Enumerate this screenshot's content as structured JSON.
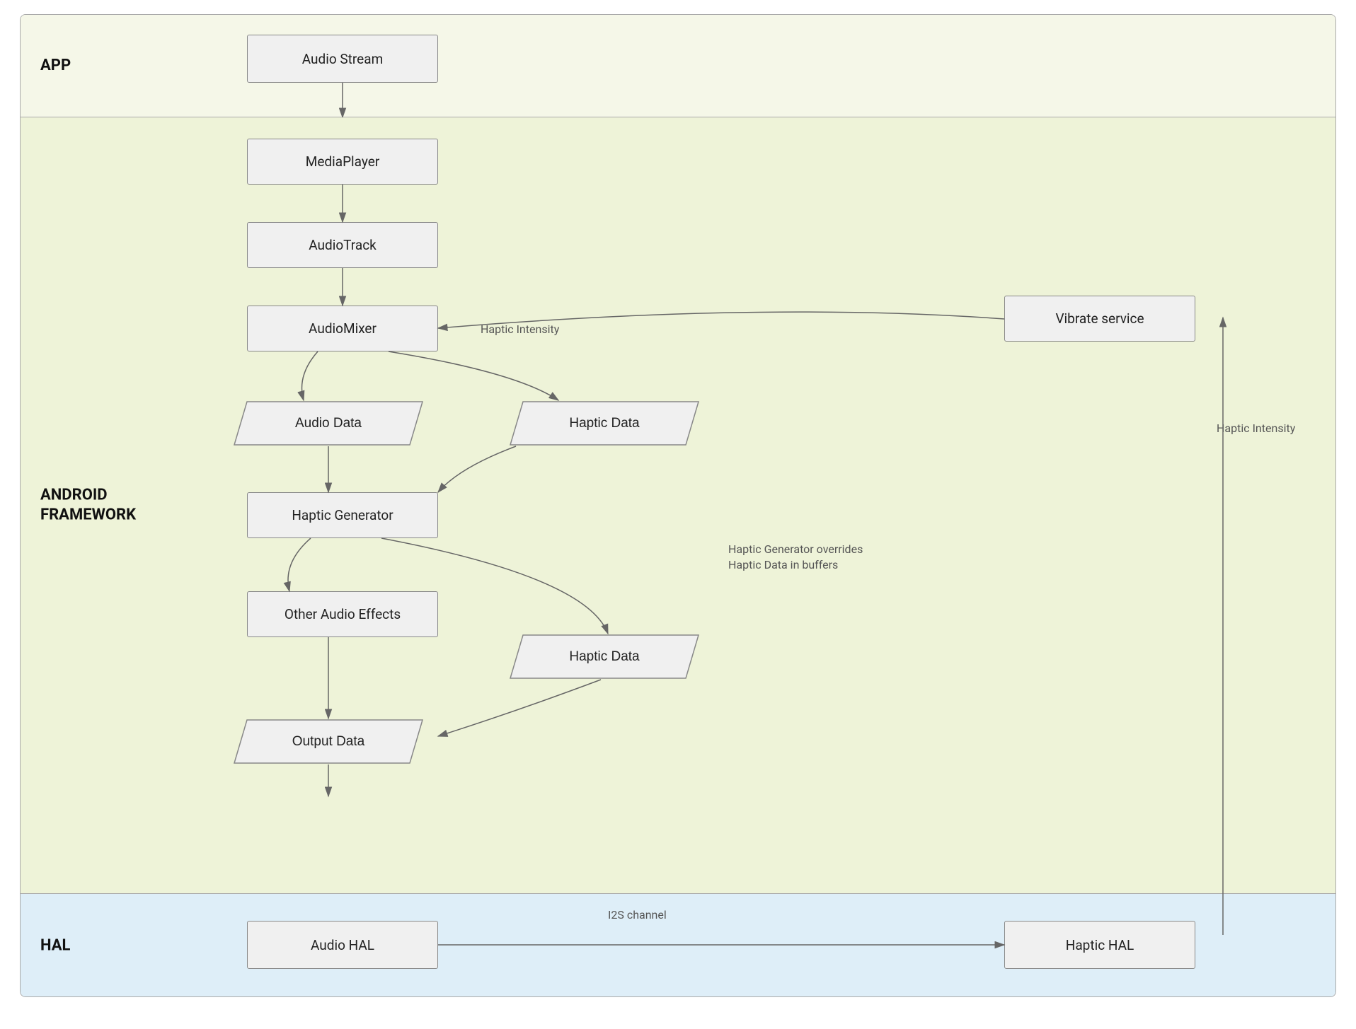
{
  "sections": {
    "app": {
      "label": "APP",
      "bg": "#f5f7e8"
    },
    "framework": {
      "label": "ANDROID\nFRAMEWORK",
      "bg": "#eef3d8"
    },
    "hal": {
      "label": "HAL",
      "bg": "#deeef8"
    }
  },
  "boxes": {
    "audio_stream": "Audio Stream",
    "media_player": "MediaPlayer",
    "audio_track": "AudioTrack",
    "audio_mixer": "AudioMixer",
    "vibrate_service": "Vibrate service",
    "audio_data": "Audio Data",
    "haptic_data_1": "Haptic Data",
    "haptic_generator": "Haptic Generator",
    "other_audio_effects": "Other Audio Effects",
    "haptic_data_2": "Haptic Data",
    "output_data": "Output Data",
    "audio_hal": "Audio HAL",
    "haptic_hal": "Haptic HAL"
  },
  "labels": {
    "haptic_intensity_top": "Haptic Intensity",
    "haptic_intensity_right": "Haptic Intensity",
    "haptic_generator_overrides": "Haptic Generator overrides\nHaptic Data in buffers",
    "i2s_channel": "I2S channel"
  }
}
